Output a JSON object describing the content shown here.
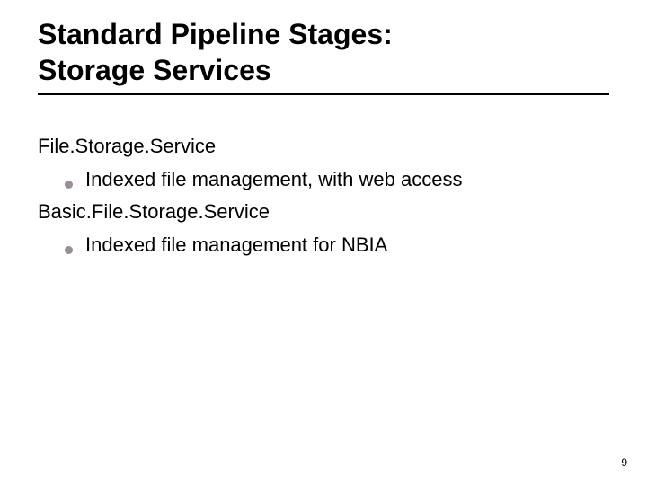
{
  "title_line1": "Standard Pipeline Stages:",
  "title_line2": "Storage Services",
  "sections": [
    {
      "heading": "File.Storage.Service",
      "bullet": "Indexed file management, with web access"
    },
    {
      "heading": "Basic.File.Storage.Service",
      "bullet": "Indexed file management for NBIA"
    }
  ],
  "page_number": "9"
}
